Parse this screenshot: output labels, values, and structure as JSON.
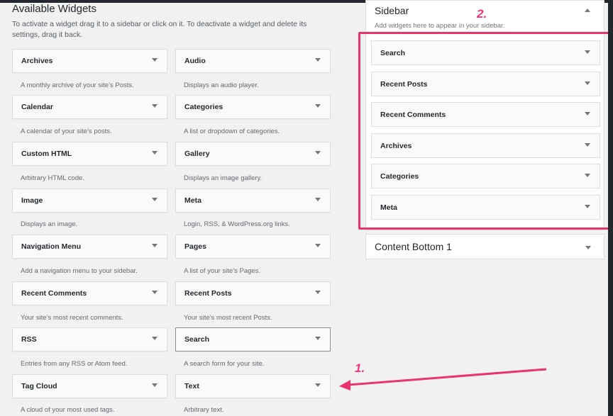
{
  "available": {
    "title": "Available Widgets",
    "description": "To activate a widget drag it to a sidebar or click on it. To deactivate a widget and delete its settings, drag it back."
  },
  "widgets": [
    {
      "label": "Archives",
      "desc": "A monthly archive of your site’s Posts."
    },
    {
      "label": "Audio",
      "desc": "Displays an audio player."
    },
    {
      "label": "Calendar",
      "desc": "A calendar of your site’s posts."
    },
    {
      "label": "Categories",
      "desc": "A list or dropdown of categories."
    },
    {
      "label": "Custom HTML",
      "desc": "Arbitrary HTML code."
    },
    {
      "label": "Gallery",
      "desc": "Displays an image gallery."
    },
    {
      "label": "Image",
      "desc": "Displays an image."
    },
    {
      "label": "Meta",
      "desc": "Login, RSS, & WordPress.org links."
    },
    {
      "label": "Navigation Menu",
      "desc": "Add a navigation menu to your sidebar."
    },
    {
      "label": "Pages",
      "desc": "A list of your site’s Pages."
    },
    {
      "label": "Recent Comments",
      "desc": "Your site’s most recent comments."
    },
    {
      "label": "Recent Posts",
      "desc": "Your site’s most recent Posts."
    },
    {
      "label": "RSS",
      "desc": "Entries from any RSS or Atom feed."
    },
    {
      "label": "Search",
      "desc": "A search form for your site."
    },
    {
      "label": "Tag Cloud",
      "desc": "A cloud of your most used tags."
    },
    {
      "label": "Text",
      "desc": "Arbitrary text."
    }
  ],
  "sidebar": {
    "title": "Sidebar",
    "description": "Add widgets here to appear in your sidebar.",
    "widgets": [
      "Search",
      "Recent Posts",
      "Recent Comments",
      "Archives",
      "Categories",
      "Meta"
    ]
  },
  "content_bottom": {
    "title": "Content Bottom 1"
  },
  "annotations": {
    "one": "1.",
    "two": "2."
  },
  "colors": {
    "highlight": "#e8356f",
    "annotation": "#ff2d7a"
  }
}
